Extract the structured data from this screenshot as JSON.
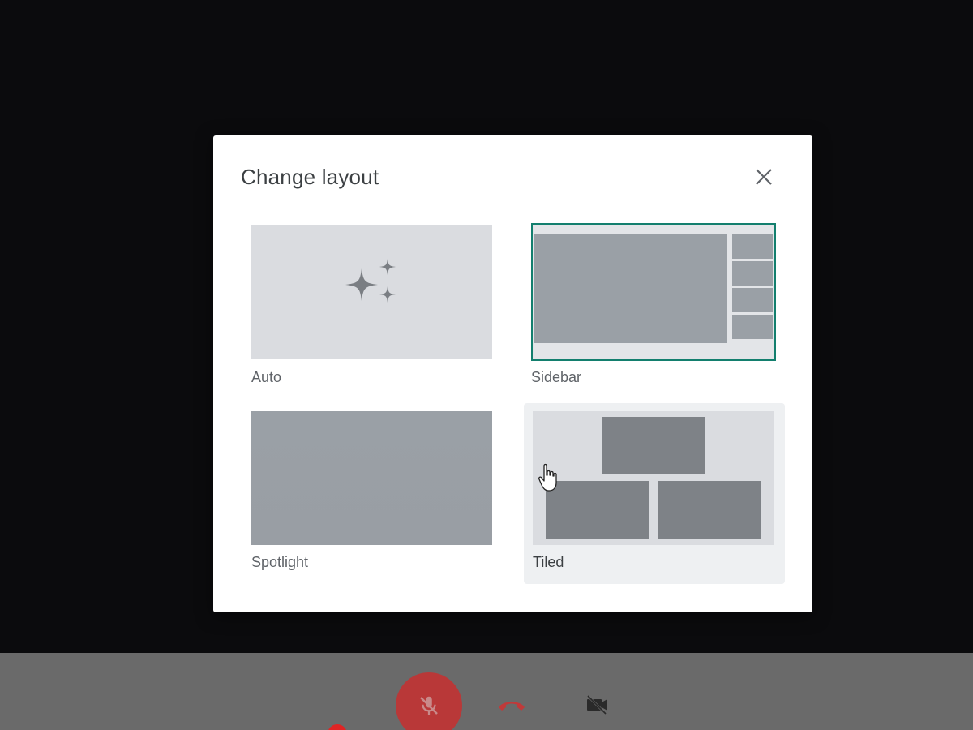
{
  "dialog": {
    "title": "Change layout",
    "close_icon": "close-icon"
  },
  "layout_options": [
    {
      "label": "Auto",
      "icon": "sparkle-icon",
      "selected": false
    },
    {
      "label": "Sidebar",
      "selected": true
    },
    {
      "label": "Spotlight",
      "selected": false
    },
    {
      "label": "Tiled",
      "selected": false,
      "hovered": true
    }
  ],
  "controls": {
    "microphone": {
      "icon": "mic-off-icon",
      "state": "muted"
    },
    "hangup": {
      "icon": "phone-hangup-icon"
    },
    "camera": {
      "icon": "video-off-icon",
      "state": "off"
    }
  },
  "colors": {
    "selected_border": "#137f6e",
    "mic_muted_bg": "#b93838",
    "hangup_red": "#d93025"
  }
}
